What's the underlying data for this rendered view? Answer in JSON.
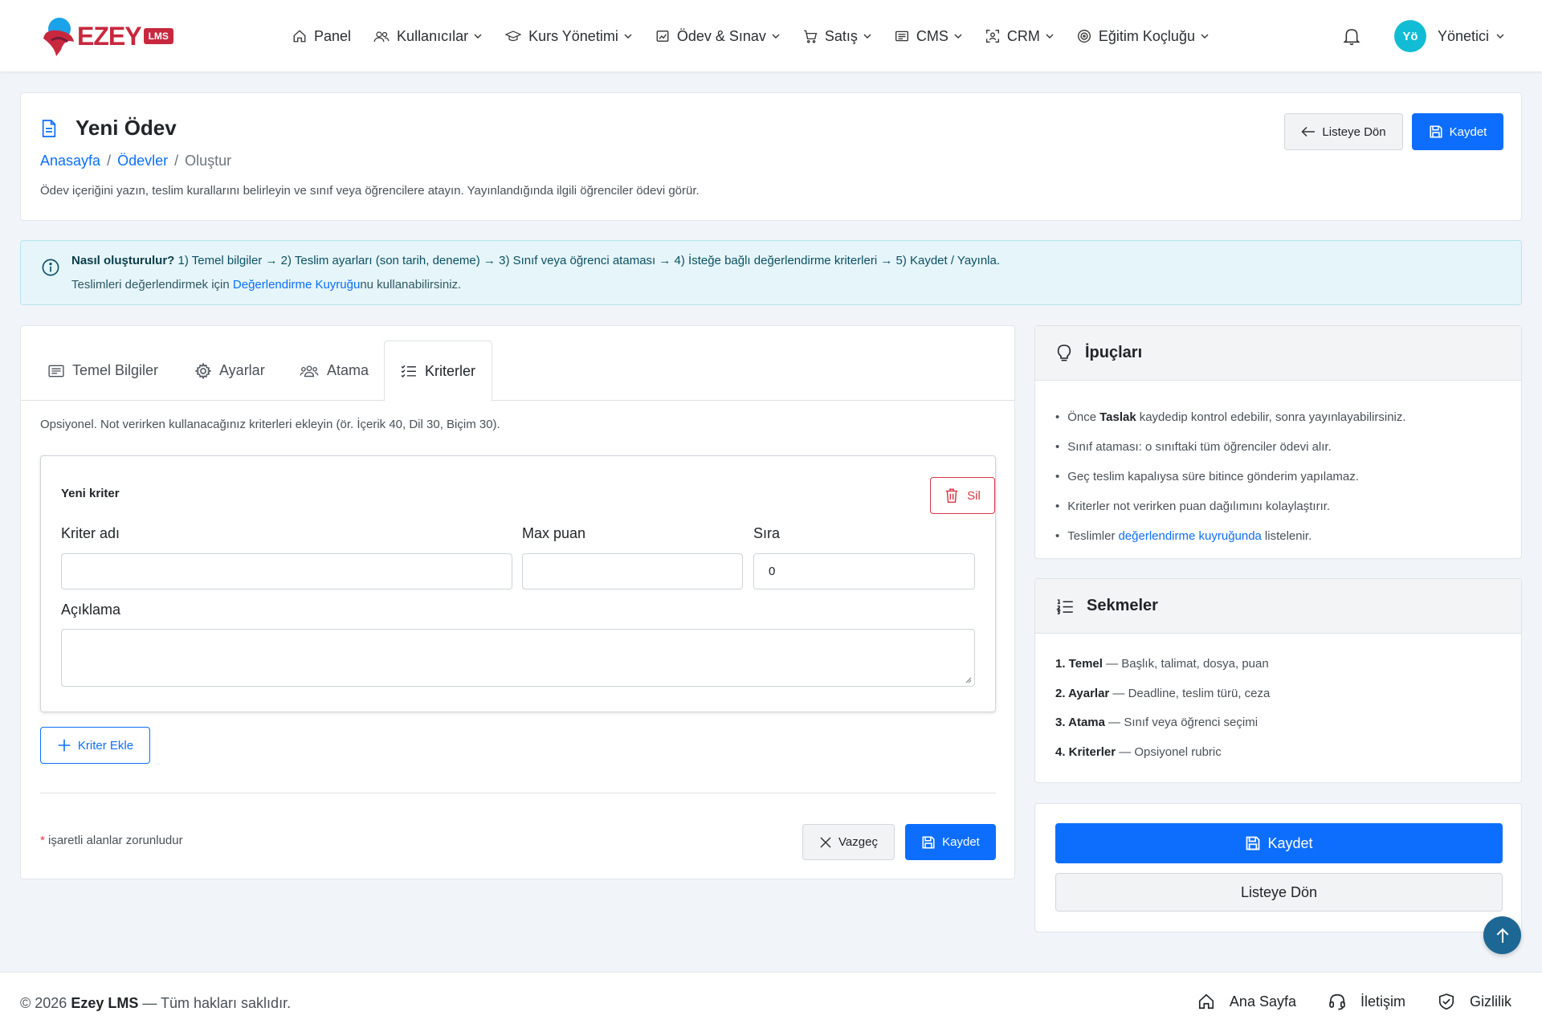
{
  "brand": {
    "name": "EZEY",
    "badge": "LMS"
  },
  "nav": {
    "items": [
      {
        "label": "Panel",
        "icon": "home-icon",
        "dropdown": false
      },
      {
        "label": "Kullanıcılar",
        "icon": "users-icon",
        "dropdown": true
      },
      {
        "label": "Kurs Yönetimi",
        "icon": "mortarboard-icon",
        "dropdown": true
      },
      {
        "label": "Ödev & Sınav",
        "icon": "clipboard-data-icon",
        "dropdown": true
      },
      {
        "label": "Satış",
        "icon": "cart-icon",
        "dropdown": true
      },
      {
        "label": "CMS",
        "icon": "newspaper-icon",
        "dropdown": true
      },
      {
        "label": "CRM",
        "icon": "person-bounding-box-icon",
        "dropdown": true
      },
      {
        "label": "Eğitim Koçluğu",
        "icon": "bullseye-icon",
        "dropdown": true
      }
    ],
    "user": {
      "initials": "Yö",
      "name": "Yönetici"
    }
  },
  "page": {
    "title": "Yeni Ödev",
    "breadcrumb": {
      "home": "Anasayfa",
      "section": "Ödevler",
      "current": "Oluştur",
      "separator": "/"
    },
    "description": "Ödev içeriğini yazın, teslim kurallarını belirleyin ve sınıf veya öğrencilere atayın. Yayınlandığında ilgili öğrenciler ödevi görür.",
    "back_label": "Listeye Dön",
    "save_label": "Kaydet"
  },
  "alert": {
    "strong": "Nasıl oluşturulur?",
    "steps": "1) Temel bilgiler → 2) Teslim ayarları (son tarih, deneme) → 3) Sınıf veya öğrenci ataması → 4) İsteğe bağlı değerlendirme kriterleri → 5) Kaydet / Yayınla.",
    "line2_prefix": "Teslimleri değerlendirmek için ",
    "line2_link": "Değerlendirme Kuyruğu",
    "line2_suffix": "nu kullanabilirsiniz."
  },
  "tabs": [
    {
      "label": "Temel Bilgiler",
      "icon": "card-text-icon",
      "active": false
    },
    {
      "label": "Ayarlar",
      "icon": "gear-icon",
      "active": false
    },
    {
      "label": "Atama",
      "icon": "people-icon",
      "active": false
    },
    {
      "label": "Kriterler",
      "icon": "list-check-icon",
      "active": true
    }
  ],
  "criteria": {
    "note": "Opsiyonel. Not verirken kullanacağınız kriterleri ekleyin (ör. İçerik 40, Dil 30, Biçim 30).",
    "item_title": "Yeni kriter",
    "delete_label": "Sil",
    "name_label": "Kriter adı",
    "name_value": "",
    "max_label": "Max puan",
    "max_value": "",
    "order_label": "Sıra",
    "order_value": "0",
    "desc_label": "Açıklama",
    "desc_value": "",
    "add_label": "Kriter Ekle"
  },
  "form_footer": {
    "required_star": "*",
    "required_note": " işaretli alanlar zorunludur",
    "cancel_label": "Vazgeç",
    "save_label": "Kaydet"
  },
  "tips": {
    "title": "İpuçları",
    "items": [
      {
        "pre": "Önce",
        "strong": "Taslak",
        "post": "kaydedip kontrol edebilir, sonra yayınlayabilirsiniz."
      },
      {
        "text": "Sınıf ataması: o sınıftaki tüm öğrenciler ödevi alır."
      },
      {
        "text": "Geç teslim kapalıysa süre bitince gönderim yapılamaz."
      },
      {
        "text": "Kriterler not verirken puan dağılımını kolaylaştırır."
      },
      {
        "pre": "Teslimler",
        "link": "değerlendirme kuyruğunda",
        "post": "listelenir."
      }
    ]
  },
  "tab_guide": {
    "title": "Sekmeler",
    "rows": [
      {
        "strong": "1. Temel",
        "text": " — Başlık, talimat, dosya, puan"
      },
      {
        "strong": "2. Ayarlar",
        "text": " — Deadline, teslim türü, ceza"
      },
      {
        "strong": "3. Atama",
        "text": " — Sınıf veya öğrenci seçimi"
      },
      {
        "strong": "4. Kriterler",
        "text": " — Opsiyonel rubric"
      }
    ]
  },
  "actions": {
    "save_label": "Kaydet",
    "back_label": "Listeye Dön"
  },
  "footer": {
    "copyright_prefix": "© 2026 ",
    "brand": "Ezey LMS",
    "copyright_suffix": " — Tüm hakları saklıdır.",
    "links": [
      {
        "label": "Ana Sayfa",
        "icon": "house-icon"
      },
      {
        "label": "İletişim",
        "icon": "headset-icon"
      },
      {
        "label": "Gizlilik",
        "icon": "shield-check-icon"
      }
    ]
  },
  "colors": {
    "primary": "#0d6efd",
    "brand": "#c8283e",
    "danger": "#dc3545",
    "info_bg": "#e5f5f9",
    "avatar": "#12bcd4",
    "fab": "#1c6794"
  }
}
